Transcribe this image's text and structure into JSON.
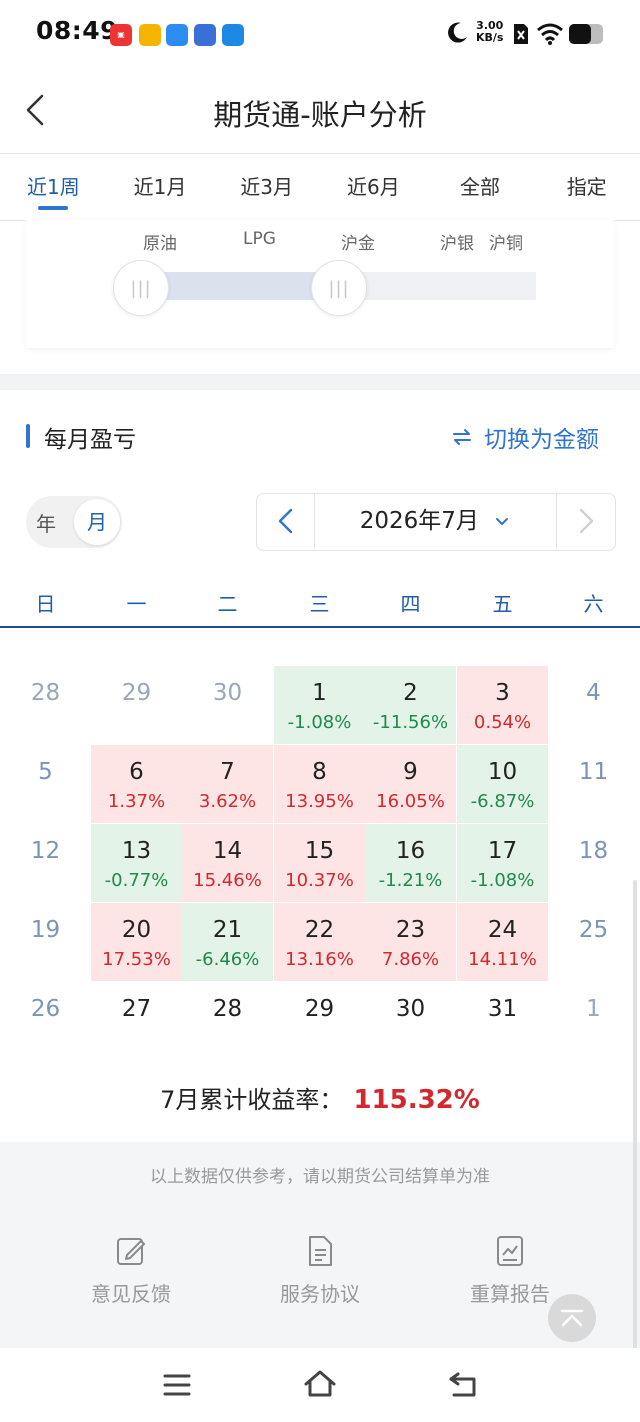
{
  "status_bar": {
    "time": "08:49",
    "network_speed": "3.00",
    "network_unit": "KB/s",
    "notification_icons": [
      "news-icon",
      "weibo-icon",
      "stock-icon",
      "vivo-icon",
      "browser-icon"
    ],
    "system_icons": [
      "moon-icon",
      "sim-off-icon",
      "wifi-icon",
      "battery-icon"
    ]
  },
  "header": {
    "title": "期货通-账户分析"
  },
  "period_tabs": [
    {
      "label": "近1周",
      "active": true
    },
    {
      "label": "近1月",
      "active": false
    },
    {
      "label": "近3月",
      "active": false
    },
    {
      "label": "近6月",
      "active": false
    },
    {
      "label": "全部",
      "active": false
    },
    {
      "label": "指定",
      "active": false
    }
  ],
  "products": {
    "labels": [
      "原油",
      "LPG",
      "沪金",
      "沪银",
      "沪铜"
    ]
  },
  "monthly_pnl": {
    "section_title": "每月盈亏",
    "switch_label": "切换为金额",
    "toggle": {
      "year": "年",
      "month": "月",
      "selected": "月"
    },
    "month_label": "2026年7月",
    "weekdays": [
      "日",
      "一",
      "二",
      "三",
      "四",
      "五",
      "六"
    ],
    "weeks": [
      [
        {
          "day": "28",
          "out": true
        },
        {
          "day": "29",
          "out": true
        },
        {
          "day": "30",
          "out": true
        },
        {
          "day": "1",
          "pct": "-1.08%"
        },
        {
          "day": "2",
          "pct": "-11.56%"
        },
        {
          "day": "3",
          "pct": "0.54%"
        },
        {
          "day": "4",
          "weekend": true
        }
      ],
      [
        {
          "day": "5",
          "weekend": true
        },
        {
          "day": "6",
          "pct": "1.37%"
        },
        {
          "day": "7",
          "pct": "3.62%"
        },
        {
          "day": "8",
          "pct": "13.95%"
        },
        {
          "day": "9",
          "pct": "16.05%"
        },
        {
          "day": "10",
          "pct": "-6.87%"
        },
        {
          "day": "11",
          "weekend": true
        }
      ],
      [
        {
          "day": "12",
          "weekend": true
        },
        {
          "day": "13",
          "pct": "-0.77%"
        },
        {
          "day": "14",
          "pct": "15.46%"
        },
        {
          "day": "15",
          "pct": "10.37%"
        },
        {
          "day": "16",
          "pct": "-1.21%"
        },
        {
          "day": "17",
          "pct": "-1.08%"
        },
        {
          "day": "18",
          "weekend": true
        }
      ],
      [
        {
          "day": "19",
          "weekend": true
        },
        {
          "day": "20",
          "pct": "17.53%"
        },
        {
          "day": "21",
          "pct": "-6.46%"
        },
        {
          "day": "22",
          "pct": "13.16%"
        },
        {
          "day": "23",
          "pct": "7.86%"
        },
        {
          "day": "24",
          "pct": "14.11%"
        },
        {
          "day": "25",
          "weekend": true
        }
      ],
      [
        {
          "day": "26",
          "weekend": true
        },
        {
          "day": "27"
        },
        {
          "day": "28"
        },
        {
          "day": "29"
        },
        {
          "day": "30"
        },
        {
          "day": "31"
        },
        {
          "day": "1",
          "out": true
        }
      ]
    ],
    "summary_label": "7月累计收益率：",
    "summary_value": "115.32%"
  },
  "footer": {
    "disclaimer": "以上数据仅供参考，请以期货公司结算单为准",
    "actions": [
      {
        "label": "意见反馈",
        "icon": "edit-icon"
      },
      {
        "label": "服务协议",
        "icon": "document-icon"
      },
      {
        "label": "重算报告",
        "icon": "report-chart-icon"
      }
    ]
  },
  "colors": {
    "accent": "#2f74d0",
    "profit": "#d4282f",
    "loss": "#1f8a4a",
    "profit_bg": "#fde4e5",
    "loss_bg": "#e4f3e8"
  }
}
